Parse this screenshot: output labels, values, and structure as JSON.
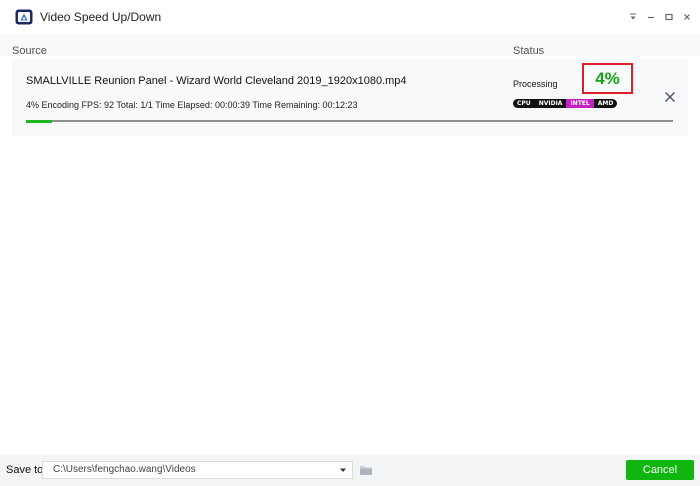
{
  "window": {
    "title": "Video Speed Up/Down"
  },
  "columns": {
    "source": "Source",
    "status": "Status"
  },
  "task": {
    "file_name": "SMALLVILLE Reunion Panel - Wizard World Cleveland 2019_1920x1080.mp4",
    "details": "4% Encoding FPS: 92 Total: 1/1 Time Elapsed: 00:00:39 Time Remaining: 00:12:23",
    "status": "Processing",
    "percent_label": "4%",
    "progress": 0.04,
    "hw_badges": [
      "CPU",
      "NVIDIA",
      "INTEL",
      "AMD"
    ],
    "active_badge": "INTEL"
  },
  "footer": {
    "save_label": "Save to:",
    "save_path": "C:\\Users\\fengchao.wang\\Videos",
    "cancel_label": "Cancel"
  },
  "colors": {
    "accent_green": "#10b510",
    "highlight_red": "#e01e2a",
    "badge_active": "#c321c3"
  },
  "icons": {
    "logo": "app-logo-icon",
    "dropdown": "menu-dropdown-icon",
    "minimize": "minimize-icon",
    "maximize": "maximize-icon",
    "close": "close-icon",
    "remove": "remove-task-icon",
    "folder": "folder-icon"
  }
}
